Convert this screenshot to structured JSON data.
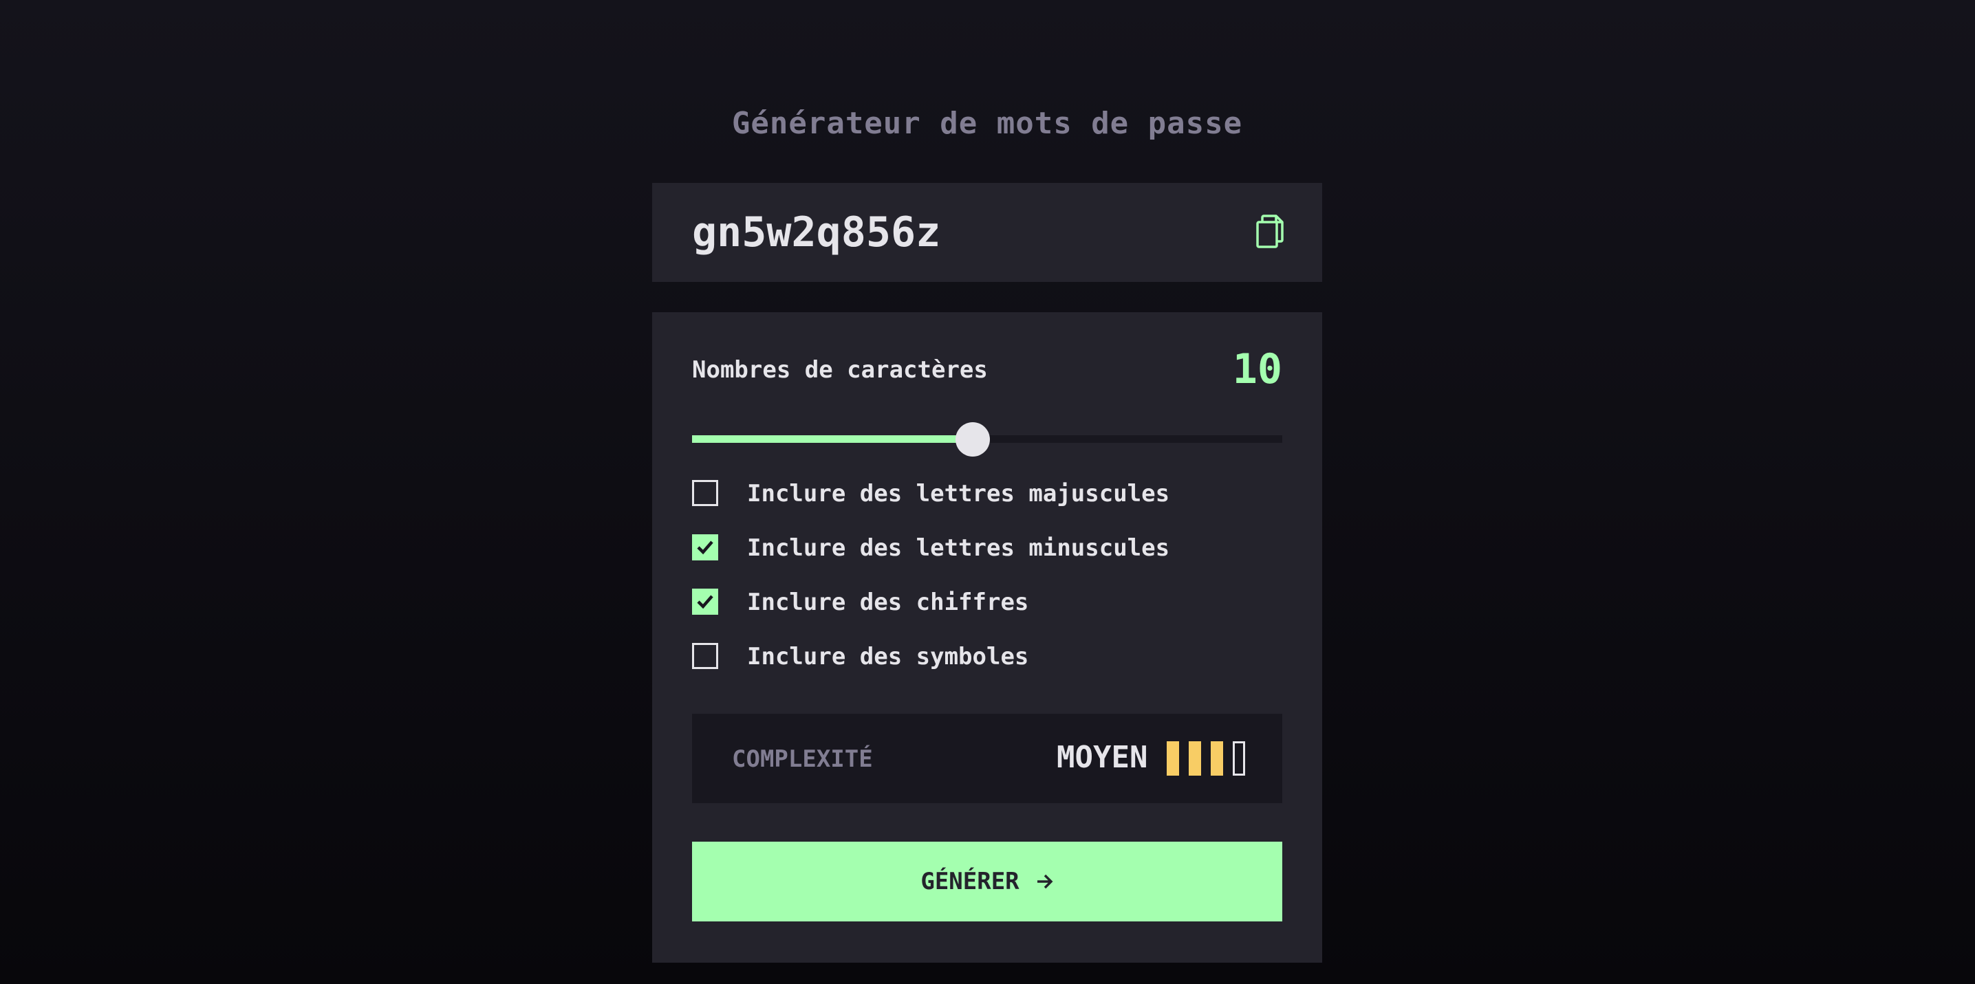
{
  "app": {
    "title": "Générateur de mots de passe"
  },
  "password": {
    "value": "gn5w2q856z",
    "copy_icon": "copy-icon"
  },
  "length": {
    "label": "Nombres de caractères",
    "value": "10",
    "slider_fraction": 0.475
  },
  "options": [
    {
      "label": "Inclure des lettres majuscules",
      "checked": false
    },
    {
      "label": "Inclure des lettres minuscules",
      "checked": true
    },
    {
      "label": "Inclure des chiffres",
      "checked": true
    },
    {
      "label": "Inclure des symboles",
      "checked": false
    }
  ],
  "strength": {
    "label": "COMPLEXITÉ",
    "value": "MOYEN",
    "bars_filled": 3,
    "bars_total": 4
  },
  "generate": {
    "label": "GÉNÉRER",
    "icon": "arrow-right-icon"
  },
  "colors": {
    "accent": "#a4ffaf",
    "strength_medium": "#f8cd65",
    "panel": "#24232c",
    "muted": "#817d92"
  }
}
